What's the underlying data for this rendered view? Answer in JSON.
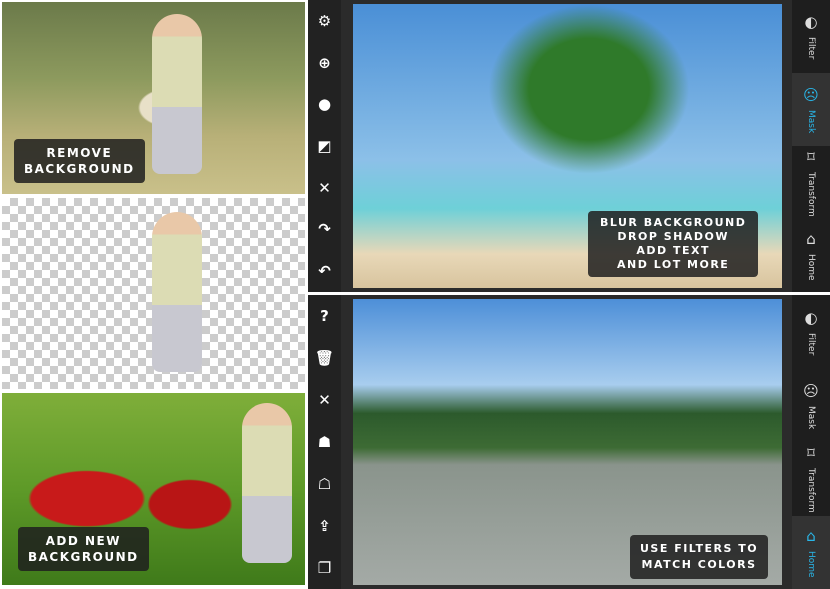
{
  "panels": {
    "remove": {
      "caption_l1": "REMOVE",
      "caption_l2": "BACKGROUND"
    },
    "add": {
      "caption_l1": "ADD NEW",
      "caption_l2": "BACKGROUND"
    },
    "top": {
      "caption": [
        "BLUR BACKGROUND",
        "DROP SHADOW",
        "ADD TEXT",
        "AND LOT MORE"
      ],
      "active_tab": "Mask"
    },
    "bottom": {
      "caption": [
        "USE FILTERS TO",
        "MATCH COLORS"
      ],
      "active_tab": "Home"
    }
  },
  "toolbar_top": [
    {
      "icon": "settings-gears-icon",
      "g": "⚙"
    },
    {
      "icon": "zoom-in-icon",
      "g": "⊕"
    },
    {
      "icon": "brush-circle-icon",
      "g": "●"
    },
    {
      "icon": "invert-icon",
      "g": "◩"
    },
    {
      "icon": "close-icon",
      "g": "✕"
    },
    {
      "icon": "redo-icon",
      "g": "↷"
    },
    {
      "icon": "undo-icon",
      "g": "↶"
    }
  ],
  "toolbar_bottom": [
    {
      "icon": "help-icon",
      "g": "?"
    },
    {
      "icon": "trash-icon",
      "g": "🗑"
    },
    {
      "icon": "tools-icon",
      "g": "✕"
    },
    {
      "icon": "mask-up-icon",
      "g": "☗"
    },
    {
      "icon": "mask-down-icon",
      "g": "☖"
    },
    {
      "icon": "share-icon",
      "g": "⇪"
    },
    {
      "icon": "layers-icon",
      "g": "❐"
    }
  ],
  "tabs": [
    {
      "label": "Filter",
      "icon": "filter-icon",
      "g": "◐"
    },
    {
      "label": "Mask",
      "icon": "mask-icon",
      "g": "☹"
    },
    {
      "label": "Transform",
      "icon": "transform-icon",
      "g": "⌑"
    },
    {
      "label": "Home",
      "icon": "home-icon",
      "g": "⌂"
    }
  ],
  "accent": "#29b6e8"
}
